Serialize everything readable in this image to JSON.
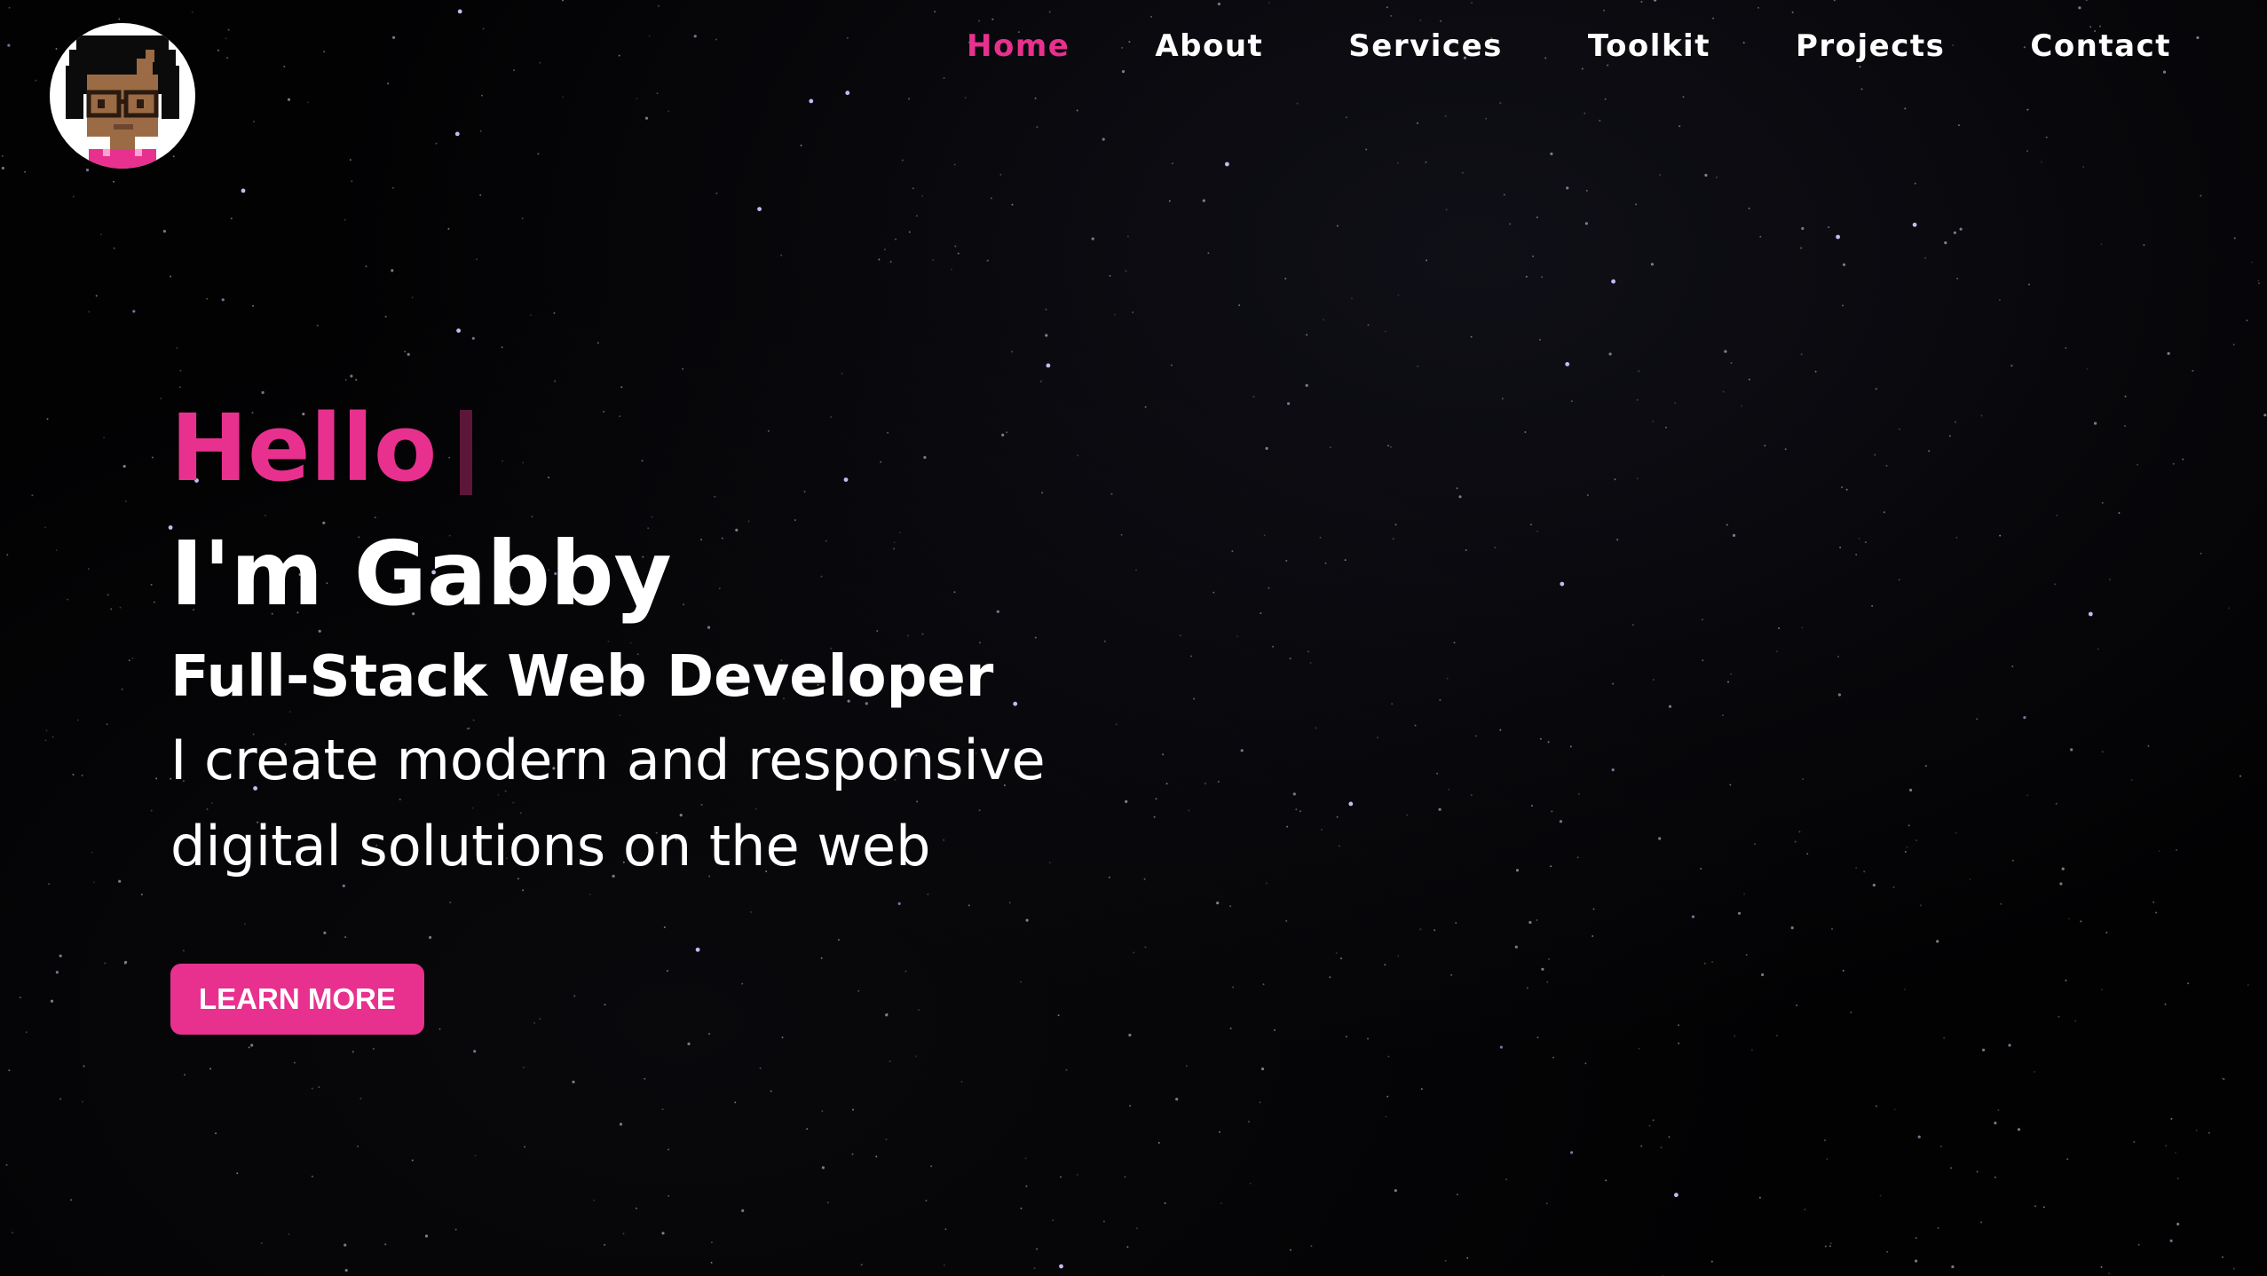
{
  "brand": {
    "logo_icon": "pixel-avatar-icon",
    "accent_color": "#e8318e"
  },
  "nav": {
    "items": [
      {
        "label": "Home",
        "active": true
      },
      {
        "label": "About",
        "active": false
      },
      {
        "label": "Services",
        "active": false
      },
      {
        "label": "Toolkit",
        "active": false
      },
      {
        "label": "Projects",
        "active": false
      },
      {
        "label": "Contact",
        "active": false
      }
    ]
  },
  "hero": {
    "greeting": "Hello",
    "name": "I'm Gabby",
    "role": "Full-Stack Web Developer",
    "tagline": "I create modern and responsive digital solutions on the web",
    "cta_label": "LEARN MORE"
  },
  "background": {
    "style": "starfield",
    "base_color": "#000000"
  }
}
